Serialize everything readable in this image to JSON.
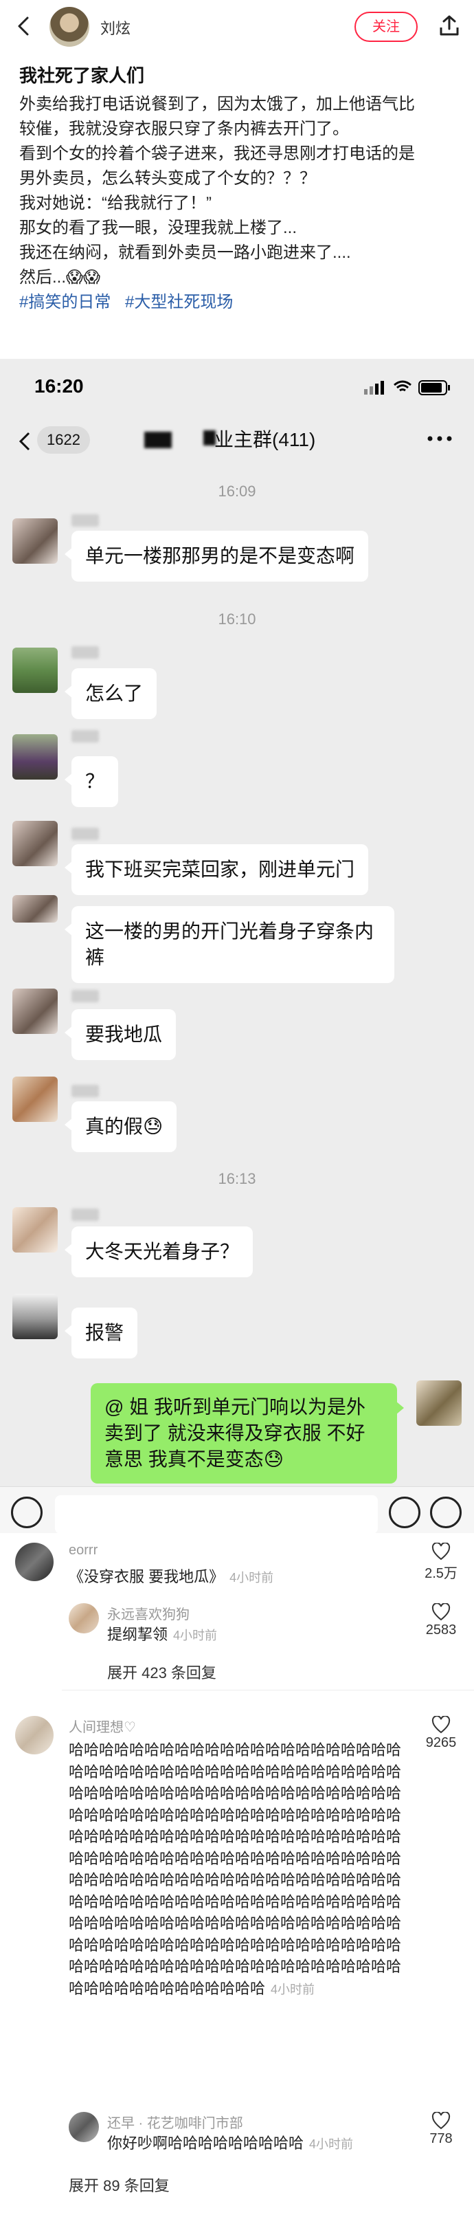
{
  "header": {
    "author": "刘炫",
    "follow_label": "关注"
  },
  "post": {
    "title": "我社死了家人们",
    "lines": [
      "外卖给我打电话说餐到了，因为太饿了，加上他语气比",
      "较催，我就没穿衣服只穿了条内裤去开门了。",
      "看到个女的拎着个袋子进来，我还寻思刚才打电话的是",
      "男外卖员，怎么转头变成了个女的？？？",
      "我对她说：“给我就行了！”",
      "那女的看了我一眼，没理我就上楼了...",
      "我还在纳闷，就看到外卖员一路小跑进来了....",
      "然后...😱😱"
    ],
    "hashtags": [
      "#搞笑的日常",
      "#大型社死现场"
    ]
  },
  "chat": {
    "status_time": "16:20",
    "unread_count": "1622",
    "group_title": "业主群(411)",
    "time_labels": [
      "16:09",
      "16:10",
      "16:13"
    ],
    "messages": [
      "单元一楼那那男的是不是变态啊",
      "怎么了",
      "？",
      "我下班买完菜回家，刚进单元门",
      "这一楼的男的开门光着身子穿条内裤",
      "要我地瓜",
      "真的假😓",
      "大冬天光着身子？",
      "报警"
    ],
    "my_message": "@ 姐 我听到单元门响以为是外卖到了 就没来得及穿衣服 不好意思 我真不是变态😓"
  },
  "comments": [
    {
      "user": "eorrr",
      "text": "《没穿衣服 要我地瓜》",
      "time": "4小时前",
      "likes": "2.5万",
      "reply": {
        "user": "永远喜欢狗狗",
        "text": "提纲挈领",
        "time": "4小时前",
        "likes": "2583"
      },
      "expand": "展开 423 条回复"
    },
    {
      "user": "人间理想♡",
      "text": "哈哈哈哈哈哈哈哈哈哈哈哈哈哈哈哈哈哈哈哈哈哈哈哈哈哈哈哈哈哈哈哈哈哈哈哈哈哈哈哈哈哈哈哈哈哈哈哈哈哈哈哈哈哈哈哈哈哈哈哈哈哈哈哈哈哈哈哈哈哈哈哈哈哈哈哈哈哈哈哈哈哈哈哈哈哈哈哈哈哈哈哈哈哈哈哈哈哈哈哈哈哈哈哈哈哈哈哈哈哈哈哈哈哈哈哈哈哈哈哈哈哈哈哈哈哈哈哈哈哈哈哈哈哈哈哈哈哈哈哈哈哈哈哈哈哈哈哈哈哈哈哈哈哈哈哈哈哈哈哈哈哈哈哈哈哈哈哈哈哈哈哈哈哈哈哈哈哈哈哈哈哈哈哈哈哈哈哈哈哈哈哈哈哈哈哈哈哈哈哈哈哈哈哈哈哈哈哈哈哈哈哈哈哈哈哈哈哈哈哈哈哈哈哈哈哈哈哈哈哈哈哈哈哈哈哈哈哈哈哈哈哈哈哈哈哈哈哈哈哈哈哈哈哈哈",
      "time": "4小时前",
      "likes": "9265",
      "reply": {
        "user": "还早 · 花艺咖啡门市部",
        "text": "你好吵啊哈哈哈哈哈哈哈哈哈",
        "time": "4小时前",
        "likes": "778"
      },
      "expand": "展开 89 条回复"
    }
  ]
}
